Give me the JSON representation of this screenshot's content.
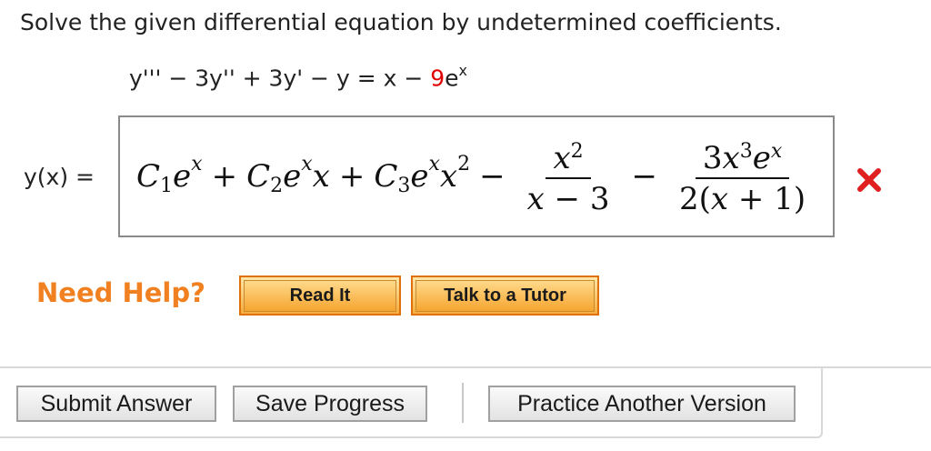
{
  "question": {
    "prompt": "Solve the given differential equation by undetermined coefficients.",
    "equation": {
      "lhs": "y''' − 3y'' + 3y' − y = x − ",
      "coefficient": "9",
      "exp_base": "e",
      "exp_power": "x"
    }
  },
  "answer": {
    "label": "y(x) =",
    "status": "incorrect",
    "status_icon": "x-mark-icon",
    "status_color": "#e02020"
  },
  "help": {
    "title": "Need Help?",
    "buttons": [
      "Read It",
      "Talk to a Tutor"
    ],
    "accent_color": "#f08020"
  },
  "actions": {
    "submit": "Submit Answer",
    "save": "Save Progress",
    "practice": "Practice Another Version"
  }
}
